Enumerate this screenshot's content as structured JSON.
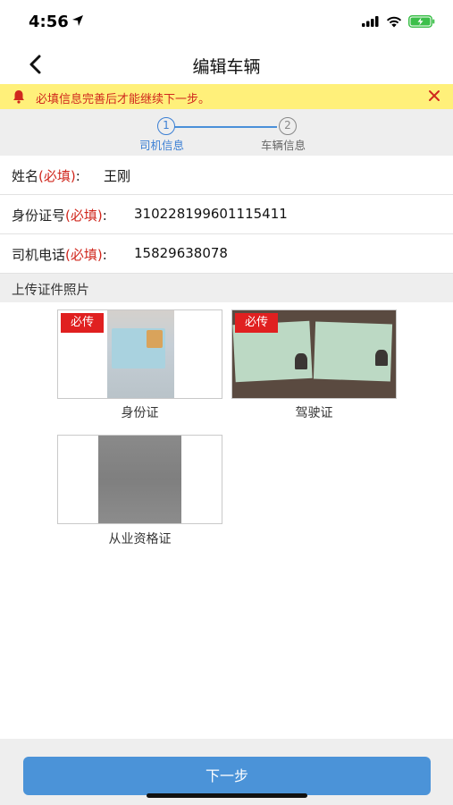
{
  "status_bar": {
    "time": "4:56"
  },
  "nav": {
    "title": "编辑车辆"
  },
  "notice": {
    "text": "必填信息完善后才能继续下一步。"
  },
  "stepper": {
    "steps": [
      {
        "number": "1",
        "label": "司机信息",
        "active": true
      },
      {
        "number": "2",
        "label": "车辆信息",
        "active": false
      }
    ]
  },
  "form": {
    "fields": [
      {
        "label": "姓名",
        "required_tag": "(必填)",
        "separator": ":",
        "value": "王刚"
      },
      {
        "label": "身份证号",
        "required_tag": "(必填)",
        "separator": ":",
        "value": "310228199601115411"
      },
      {
        "label": "司机电话",
        "required_tag": "(必填)",
        "separator": ":",
        "value": "15829638078"
      }
    ]
  },
  "uploads": {
    "section_title": "上传证件照片",
    "items": [
      {
        "badge": "必传",
        "caption": "身份证"
      },
      {
        "badge": "必传",
        "caption": "驾驶证"
      },
      {
        "badge": "",
        "caption": "从业资格证"
      }
    ]
  },
  "footer": {
    "next_label": "下一步"
  },
  "colors": {
    "accent": "#4b93d8",
    "required": "#d0281e",
    "notice_bg": "#fff07a",
    "badge_bg": "#e02020"
  }
}
